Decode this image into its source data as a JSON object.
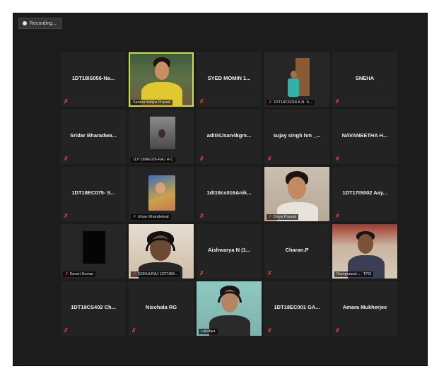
{
  "recording": {
    "label": "Recording..."
  },
  "tiles": [
    {
      "name": "1DT18IS056-Na...",
      "kind": "name"
    },
    {
      "name": "",
      "label": "Sankar Aditya Prasad",
      "kind": "video",
      "active": true
    },
    {
      "name": "SYED MOMIN 1...",
      "kind": "name"
    },
    {
      "name": "",
      "label": "1DT18CS018 A.N. S...",
      "kind": "video"
    },
    {
      "name": "SNEHA",
      "kind": "name"
    },
    {
      "name": "Sridar Bharadwa...",
      "kind": "name"
    },
    {
      "name": "",
      "label": "1DT18ME026-RAJ H C",
      "kind": "video"
    },
    {
      "name": "aditi4Jsan4kgm...",
      "kind": "name"
    },
    {
      "name": "sujay singh hm _...",
      "kind": "name"
    },
    {
      "name": "NAVANEETHA H...",
      "kind": "name"
    },
    {
      "name": "1DT18EC075- S...",
      "kind": "name"
    },
    {
      "name": "",
      "label": "Utsav Khandelwal",
      "kind": "video"
    },
    {
      "name": "1dt18cs016Anik...",
      "kind": "name"
    },
    {
      "name": "",
      "label": "Divya Prasad",
      "kind": "video"
    },
    {
      "name": "1DT17IS002 Aay...",
      "kind": "name"
    },
    {
      "name": "",
      "label": "Kaveri Kumar",
      "kind": "video"
    },
    {
      "name": "",
      "label": "GOKULRAJ 1DT18M...",
      "kind": "video"
    },
    {
      "name": "Aishwarya N (1...",
      "kind": "name"
    },
    {
      "name": "Charan.P",
      "kind": "name"
    },
    {
      "name": "",
      "label": "Ramprasad... - TPO",
      "kind": "video"
    },
    {
      "name": "1DT19CS402 Ch...",
      "kind": "name"
    },
    {
      "name": "Nischala RG",
      "kind": "name"
    },
    {
      "name": "",
      "label": "Lakshya",
      "kind": "video"
    },
    {
      "name": "1DT18EC001 GA...",
      "kind": "name"
    },
    {
      "name": "Amara Mukherjee",
      "kind": "name"
    }
  ],
  "colors": {
    "background": "#1c1c1c",
    "tile": "#232323",
    "active_border": "#c9e04a",
    "mute": "#e23b3b"
  }
}
